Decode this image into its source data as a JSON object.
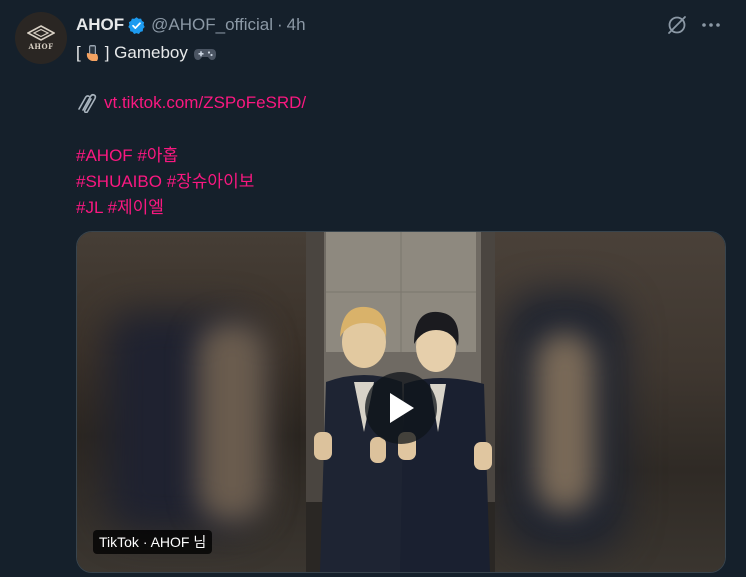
{
  "tweet": {
    "author_name": "AHOF",
    "handle": "@AHOF_official",
    "separator": "·",
    "time": "4h",
    "avatar_text": "AHOF",
    "line1_open": "[",
    "line1_close": "] Gameboy",
    "link": "vt.tiktok.com/ZSPoFeSRD/",
    "hashtags": [
      "#AHOF #아홉",
      "#SHUAIBO #장슈아이보",
      "#JL #제이엘"
    ]
  },
  "media": {
    "caption": "TikTok · AHOF 님"
  },
  "colors": {
    "background": "#15202b",
    "link": "#f91880",
    "muted": "#8b98a5",
    "verified": "#1d9bf0"
  }
}
